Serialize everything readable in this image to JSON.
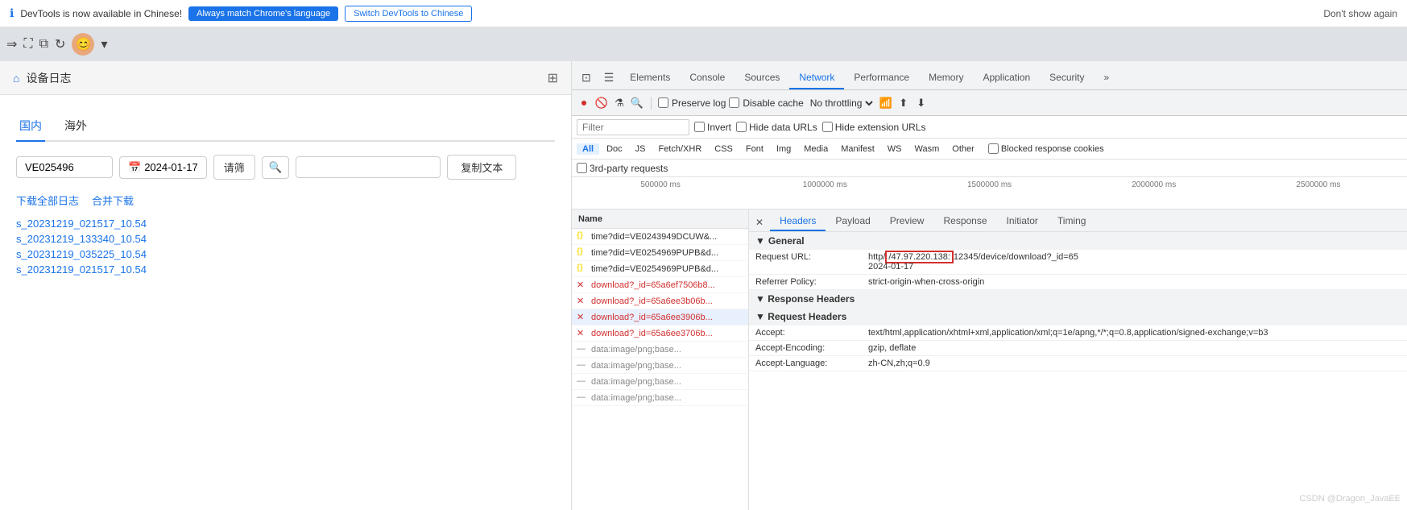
{
  "notification": {
    "icon": "ℹ",
    "text": "DevTools is now available in Chinese!",
    "btn_match": "Always match Chrome's language",
    "btn_switch": "Switch DevTools to Chinese",
    "dont_show": "Don't show again"
  },
  "browser": {
    "nav_icon": "⇒",
    "expand_icon": "⛶",
    "device_icon": "⧉",
    "refresh_icon": "↻"
  },
  "left_panel": {
    "home_icon": "⌂",
    "page_title": "设备日志",
    "grid_icon": "⊞",
    "tabs": [
      "国内",
      "海外"
    ],
    "active_tab": 0,
    "filter_placeholder": "VE025496",
    "date_icon": "📅",
    "date_value": "2024-01-17",
    "filter_btn": "请筛",
    "copy_btn": "复制文本",
    "download_all": "下载全部日志",
    "merge_download": "合并下载",
    "files": [
      "s_20231219_021517_10.54",
      "s_20231219_133340_10.54",
      "s_20231219_035225_10.54",
      "s_20231219_021517_10.54"
    ]
  },
  "devtools": {
    "tabs": [
      {
        "label": "⊡",
        "type": "icon"
      },
      {
        "label": "☰",
        "type": "icon"
      },
      {
        "label": "Elements"
      },
      {
        "label": "Console"
      },
      {
        "label": "Sources"
      },
      {
        "label": "Network",
        "active": true
      },
      {
        "label": "Performance"
      },
      {
        "label": "Memory"
      },
      {
        "label": "Application"
      },
      {
        "label": "Security"
      },
      {
        "label": "»",
        "type": "icon"
      }
    ],
    "toolbar": {
      "record_icon": "⏺",
      "clear_icon": "🚫",
      "filter_icon": "⚗",
      "search_icon": "🔍",
      "preserve_log": "Preserve log",
      "disable_cache": "Disable cache",
      "throttle": "No throttling",
      "wifi_icon": "📶",
      "upload_icon": "⬆",
      "download_icon": "⬇"
    },
    "filter_bar": {
      "placeholder": "Filter",
      "invert": "Invert",
      "hide_data_urls": "Hide data URLs",
      "hide_ext_urls": "Hide extension URLs"
    },
    "type_filters": [
      "All",
      "Doc",
      "JS",
      "Fetch/XHR",
      "CSS",
      "Font",
      "Img",
      "Media",
      "Manifest",
      "WS",
      "Wasm",
      "Other"
    ],
    "active_type": "All",
    "blocked_label": "Blocked response cookies",
    "third_party": "3rd-party requests",
    "timeline_labels": [
      "500000 ms",
      "1000000 ms",
      "1500000 ms",
      "2000000 ms",
      "2500000 ms"
    ],
    "request_list": {
      "header": "Name",
      "items": [
        {
          "icon": "js",
          "name": "time?did=VE0243949DCUW&...",
          "type": "js"
        },
        {
          "icon": "js",
          "name": "time?did=VE0254969PUPB&d...",
          "type": "js"
        },
        {
          "icon": "js",
          "name": "time?did=VE0254969PUPB&d...",
          "type": "js"
        },
        {
          "icon": "error",
          "name": "download?_id=65a6ef7506b8...",
          "type": "error"
        },
        {
          "icon": "error",
          "name": "download?_id=65a6ee3b06b...",
          "type": "error"
        },
        {
          "icon": "error",
          "name": "download?_id=65a6ee3906b...",
          "type": "error",
          "selected": true
        },
        {
          "icon": "error",
          "name": "download?_id=65a6ee3706b...",
          "type": "error"
        },
        {
          "icon": "data",
          "name": "data:image/png;base...",
          "type": "data"
        },
        {
          "icon": "data",
          "name": "data:image/png;base...",
          "type": "data"
        },
        {
          "icon": "data",
          "name": "data:image/png;base...",
          "type": "data"
        },
        {
          "icon": "data",
          "name": "data:image/png;base...",
          "type": "data"
        }
      ]
    },
    "details": {
      "close_btn": "✕",
      "tabs": [
        "Headers",
        "Payload",
        "Preview",
        "Response",
        "Initiator",
        "Timing"
      ],
      "active_tab": "Headers",
      "general_section": "General",
      "request_url_key": "Request URL:",
      "request_url_val": "http://47.97.220.138:12345/device/download?_id=65",
      "request_url_highlight": "47.97.220.138:",
      "date_val": "2024-01-17",
      "referrer_policy_key": "Referrer Policy:",
      "referrer_policy_val": "strict-origin-when-cross-origin",
      "response_headers_section": "▼ Response Headers",
      "request_headers_section": "▼ Request Headers",
      "accept_key": "Accept:",
      "accept_val": "text/html,application/xhtml+xml,application/xml;q=1e/apng,*/*;q=0.8,application/signed-exchange;v=b3",
      "accept_encoding_key": "Accept-Encoding:",
      "accept_encoding_val": "gzip, deflate",
      "accept_language_key": "Accept-Language:",
      "accept_language_val": "zh-CN,zh;q=0.9"
    }
  },
  "watermark": "CSDN @Dragon_JavaEE"
}
